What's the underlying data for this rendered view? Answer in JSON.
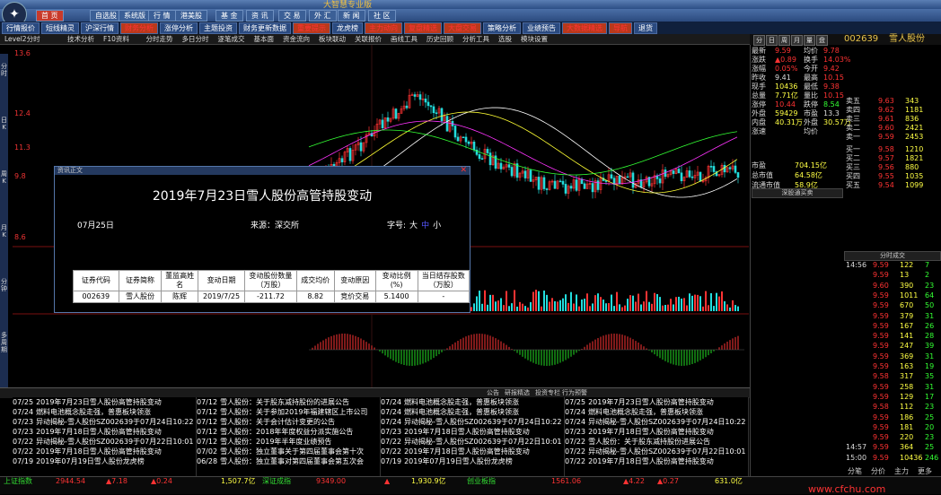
{
  "window": {
    "title": "大智慧专业版"
  },
  "menu": [
    {
      "label": "首 页",
      "active": true
    },
    {
      "label": "自选股"
    },
    {
      "label": "系统版"
    },
    {
      "label": "行 情"
    },
    {
      "label": "港美股"
    },
    {
      "label": "基 金"
    },
    {
      "label": "资 讯"
    },
    {
      "label": "交 易"
    },
    {
      "label": "外 汇"
    },
    {
      "label": "新 闻"
    },
    {
      "label": "社 区"
    }
  ],
  "funcbar": [
    {
      "label": "行情报价",
      "red": false
    },
    {
      "label": "短线精灵",
      "red": false
    },
    {
      "label": "沪深行情",
      "red": false
    },
    {
      "label": "财务分析",
      "red": true
    },
    {
      "label": "涨停分析",
      "red": false
    },
    {
      "label": "主题投资",
      "red": false
    },
    {
      "label": "财务更新数据",
      "red": false
    },
    {
      "label": "重要提示",
      "red": true
    },
    {
      "label": "龙虎榜",
      "red": false
    },
    {
      "label": "主力动向",
      "red": true
    },
    {
      "label": "复盘精选",
      "red": true
    },
    {
      "label": "大盘交易",
      "red": true
    },
    {
      "label": "策略分析",
      "red": false
    },
    {
      "label": "业绩预告",
      "red": false
    },
    {
      "label": "大数据精选",
      "red": true
    },
    {
      "label": "导航",
      "red": true
    },
    {
      "label": "退货",
      "red": false
    }
  ],
  "toolbar": [
    "Level2分时",
    "技术分析",
    "F10资料",
    "分时走势",
    "多日分时",
    "逐笔成交",
    "基本面",
    "资金流向",
    "板块联动",
    "关联报价",
    "画线工具",
    "历史回顾",
    "分析工具",
    "选股",
    "模块设置"
  ],
  "y_axis": [
    "13.6",
    "12.4",
    "11.3",
    "9.8",
    "8.6"
  ],
  "sidetabs": [
    "分时",
    "日K",
    "周K",
    "月K",
    "分钟",
    "多周期"
  ],
  "popup": {
    "window_label": "资讯正文",
    "heading": "2019年7月23日雪人股份高管持股变动",
    "date": "07月25日",
    "source": "来源：深交所",
    "font_label": "字号:",
    "font_sizes": [
      "大",
      "中",
      "小"
    ],
    "table_headers": [
      "证券代码",
      "证券简称",
      "董监高姓名",
      "变动日期",
      "变动股份数量（万股）",
      "成交均价",
      "变动原因",
      "变动比例(%)",
      "当日结存股数（万股）"
    ],
    "table_row": [
      "002639",
      "雪人股份",
      "陈辉",
      "2019/7/25",
      "-211.72",
      "8.82",
      "竞价交易",
      "5.1400",
      "-"
    ]
  },
  "indicator_text": "MACD(12,26,9) DIF:-0.063  DEA:0.045  MACD:-0.217",
  "news_tabs": [
    "公告",
    "研报精选",
    "投资专栏",
    "行为预警"
  ],
  "news": [
    [
      {
        "d": "07/25",
        "t": "2019年7月23日雪人股份高管持股变动"
      },
      {
        "d": "07/24",
        "t": "燃料电池概念股走强，普惠板块领涨"
      },
      {
        "d": "07/23",
        "t": "异动揭秘-雪人股份SZ002639于07月24日10:22"
      },
      {
        "d": "07/23",
        "t": "2019年7月18日雪人股份高管持股变动"
      },
      {
        "d": "07/22",
        "t": "异动揭秘-雪人股份SZ002639于07月22日10:01"
      },
      {
        "d": "07/22",
        "t": "2019年7月18日雪人股份高管持股变动"
      },
      {
        "d": "07/19",
        "t": "2019年07月19日雪人股份龙虎榜"
      }
    ],
    [
      {
        "d": "07/12",
        "t": "雪人股份：关于股东减持股份的进展公告"
      },
      {
        "d": "07/12",
        "t": "雪人股份：关于参加2019年福建辖区上市公司"
      },
      {
        "d": "07/12",
        "t": "雪人股份：关于会计估计变更的公告"
      },
      {
        "d": "07/12",
        "t": "雪人股份：2018年年度权益分派实施公告"
      },
      {
        "d": "07/12",
        "t": "雪人股份：2019年半年度业绩预告"
      },
      {
        "d": "07/02",
        "t": "雪人股份：独立董事关于第四届董事会第十次"
      },
      {
        "d": "06/28",
        "t": "雪人股份：独立董事对第四届董事会第五次会"
      }
    ],
    [
      {
        "d": "07/24",
        "t": "燃料电池概念股走强，普惠板块领涨"
      },
      {
        "d": "07/24",
        "t": "燃料电池概念股走强，普惠板块领涨"
      },
      {
        "d": "07/24",
        "t": "异动揭秘-雪人股份SZ002639于07月24日10:22"
      },
      {
        "d": "07/23",
        "t": "2019年7月18日雪人股份高管持股变动"
      },
      {
        "d": "07/22",
        "t": "异动揭秘-雪人股份SZ002639于07月22日10:01"
      },
      {
        "d": "07/22",
        "t": "2019年7月18日雪人股份高管持股变动"
      },
      {
        "d": "07/19",
        "t": "2019年07月19日雪人股份龙虎榜"
      }
    ],
    [
      {
        "d": "07/25",
        "t": "2019年7月23日雪人股份高管持股变动"
      },
      {
        "d": "07/24",
        "t": "燃料电池概念股走强，普惠板块领涨"
      },
      {
        "d": "07/24",
        "t": "异动揭秘-雪人股份SZ002639于07月24日10:22"
      },
      {
        "d": "07/23",
        "t": "2019年7月18日雪人股份高管持股变动"
      },
      {
        "d": "07/22",
        "t": "雪人股份：关于股东减持股份进展公告"
      },
      {
        "d": "07/22",
        "t": "异动揭秘-雪人股份SZ002639于07月22日10:01"
      },
      {
        "d": "07/22",
        "t": "2019年7月18日雪人股份高管持股变动"
      }
    ]
  ],
  "status": [
    {
      "label": "上证指数",
      "color": "#33dd33"
    },
    {
      "label": "2944.54",
      "color": "#ff3333"
    },
    {
      "label": "▲7.18",
      "color": "#ff3333"
    },
    {
      "label": "▲0.24",
      "color": "#ff3333"
    },
    {
      "label": "1,507.7亿",
      "color": "#ffff44"
    },
    {
      "label": "深证成指",
      "color": "#33dd33"
    },
    {
      "label": "9349.00",
      "color": "#ff3333"
    },
    {
      "label": "▲",
      "color": "#ff3333"
    },
    {
      "label": "1,930.9亿",
      "color": "#ffff44"
    },
    {
      "label": "创业板指",
      "color": "#33dd33"
    },
    {
      "label": "1561.06",
      "color": "#ff3333"
    },
    {
      "label": "▲4.22",
      "color": "#ff3333"
    },
    {
      "label": "▲0.27",
      "color": "#ff3333"
    },
    {
      "label": "631.0亿",
      "color": "#ffff44"
    }
  ],
  "stock": {
    "code": "002639",
    "name": "雪人股份",
    "tabs": [
      "分",
      "日",
      "周",
      "月",
      "量",
      "盘"
    ]
  },
  "quote": [
    {
      "k": "最新",
      "v": "9.59",
      "c": "red"
    },
    {
      "k": "涨跌",
      "v": "▲0.89",
      "c": "red"
    },
    {
      "k": "涨幅",
      "v": "0.05%",
      "c": "red"
    },
    {
      "k": "昨收",
      "v": "9.41",
      "c": "wht"
    },
    {
      "k": "现手",
      "v": "10436",
      "c": "yel"
    },
    {
      "k": "总量",
      "v": "7.71亿",
      "c": "yel"
    },
    {
      "k": "涨停",
      "v": "10.44",
      "c": "red"
    },
    {
      "k": "外盘",
      "v": "59429",
      "c": "yel"
    },
    {
      "k": "内盘",
      "v": "40.31万",
      "c": "yel"
    },
    {
      "k": "涨速",
      "v": "",
      "c": "wht"
    }
  ],
  "quote2": [
    {
      "k": "均价",
      "v": "9.78",
      "c": "red"
    },
    {
      "k": "换手",
      "v": "14.03%",
      "c": "red"
    },
    {
      "k": "今开",
      "v": "9.42",
      "c": "red"
    },
    {
      "k": "最高",
      "v": "10.15",
      "c": "red"
    },
    {
      "k": "最低",
      "v": "9.38",
      "c": "red"
    },
    {
      "k": "量比",
      "v": "10.15",
      "c": "red"
    },
    {
      "k": "跌停",
      "v": "8.54",
      "c": "green"
    },
    {
      "k": "市盈",
      "v": "13.3",
      "c": "wht"
    },
    {
      "k": "外盘",
      "v": "30.57万",
      "c": "yel"
    },
    {
      "k": "均价",
      "v": "",
      "c": "wht"
    }
  ],
  "orderbook": [
    {
      "l": "卖五",
      "p": "9.63",
      "v": "343"
    },
    {
      "l": "卖四",
      "p": "9.62",
      "v": "1181"
    },
    {
      "l": "卖三",
      "p": "9.61",
      "v": "836"
    },
    {
      "l": "卖二",
      "p": "9.60",
      "v": "2421"
    },
    {
      "l": "卖一",
      "p": "9.59",
      "v": "2453"
    },
    {
      "l": "买一",
      "p": "9.58",
      "v": "1210"
    },
    {
      "l": "买二",
      "p": "9.57",
      "v": "1821"
    },
    {
      "l": "买三",
      "p": "9.56",
      "v": "880"
    },
    {
      "l": "买四",
      "p": "9.55",
      "v": "1035"
    },
    {
      "l": "买五",
      "p": "9.54",
      "v": "1099"
    }
  ],
  "extra": [
    {
      "k": "市盈",
      "v": "704.15亿"
    },
    {
      "k": "总市值",
      "v": "64.58亿"
    },
    {
      "k": "流通市值",
      "v": "58.9亿"
    }
  ],
  "section_labels": {
    "levels": "深股通买卖",
    "ticks": "分时成交"
  },
  "ticks": [
    {
      "t": "14:56",
      "p": "9.59",
      "v": "122",
      "f": "7"
    },
    {
      "t": "",
      "p": "9.59",
      "v": "13",
      "f": "2"
    },
    {
      "t": "",
      "p": "9.60",
      "v": "390",
      "f": "23"
    },
    {
      "t": "",
      "p": "9.59",
      "v": "1011",
      "f": "64"
    },
    {
      "t": "",
      "p": "9.59",
      "v": "670",
      "f": "50"
    },
    {
      "t": "",
      "p": "9.59",
      "v": "379",
      "f": "31"
    },
    {
      "t": "",
      "p": "9.59",
      "v": "167",
      "f": "26"
    },
    {
      "t": "",
      "p": "9.59",
      "v": "141",
      "f": "28"
    },
    {
      "t": "",
      "p": "9.59",
      "v": "247",
      "f": "39"
    },
    {
      "t": "",
      "p": "9.59",
      "v": "369",
      "f": "31"
    },
    {
      "t": "",
      "p": "9.59",
      "v": "163",
      "f": "19"
    },
    {
      "t": "",
      "p": "9.58",
      "v": "317",
      "f": "35"
    },
    {
      "t": "",
      "p": "9.59",
      "v": "258",
      "f": "31"
    },
    {
      "t": "",
      "p": "9.59",
      "v": "129",
      "f": "17"
    },
    {
      "t": "",
      "p": "9.58",
      "v": "112",
      "f": "23"
    },
    {
      "t": "",
      "p": "9.59",
      "v": "186",
      "f": "25"
    },
    {
      "t": "",
      "p": "9.59",
      "v": "181",
      "f": "20"
    },
    {
      "t": "",
      "p": "9.59",
      "v": "220",
      "f": "23"
    },
    {
      "t": "14:57",
      "p": "9.59",
      "v": "364",
      "f": "25"
    },
    {
      "t": "15:00",
      "p": "9.59",
      "v": "10436",
      "f": "246"
    }
  ],
  "bottom_tabs": [
    "分笔",
    "分价",
    "主力",
    "更多"
  ],
  "watermark": "www.cfchu.com",
  "price_labels": {
    "high": "10.15",
    "low": "8.60"
  }
}
